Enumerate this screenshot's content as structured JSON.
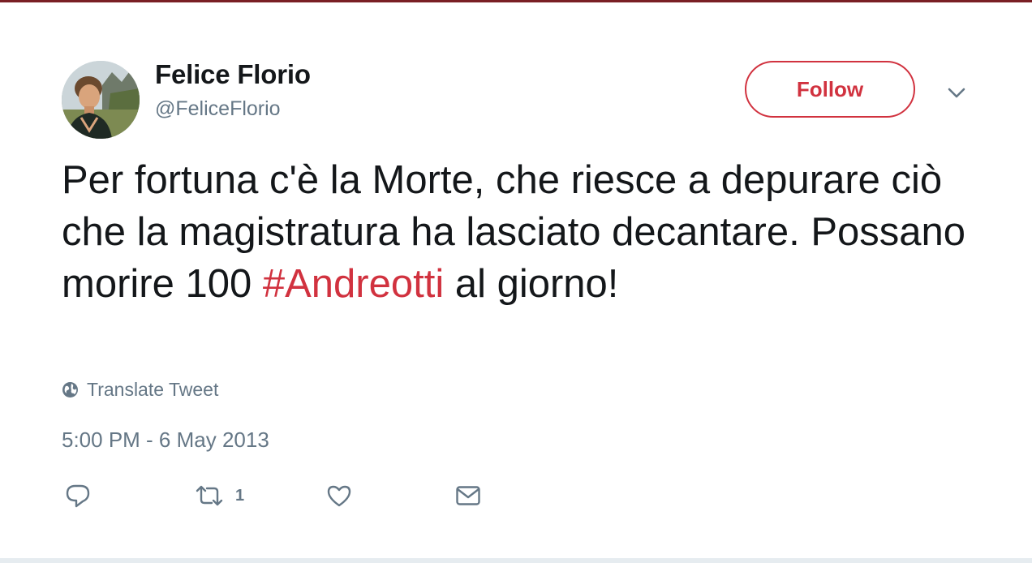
{
  "tweet": {
    "author": {
      "display_name": "Felice Florio",
      "handle": "@FeliceFlorio",
      "avatar_icon": "profile-photo"
    },
    "follow_label": "Follow",
    "text_parts": {
      "before": "Per fortuna c'è la Morte, che riesce a depurare ciò che la magistratura ha lasciato decantare. Possano morire 100 ",
      "hashtag": "#Andreotti",
      "after": " al giorno!"
    },
    "translate_label": "Translate Tweet",
    "timestamp": "5:00 PM - 6 May 2013",
    "actions": {
      "reply_icon": "reply-icon",
      "retweet_icon": "retweet-icon",
      "retweet_count": "1",
      "like_icon": "heart-icon",
      "dm_icon": "envelope-icon"
    }
  },
  "colors": {
    "accent": "#d1323f",
    "text": "#14171a",
    "muted": "#657786",
    "top_rule": "#7a1f24"
  }
}
